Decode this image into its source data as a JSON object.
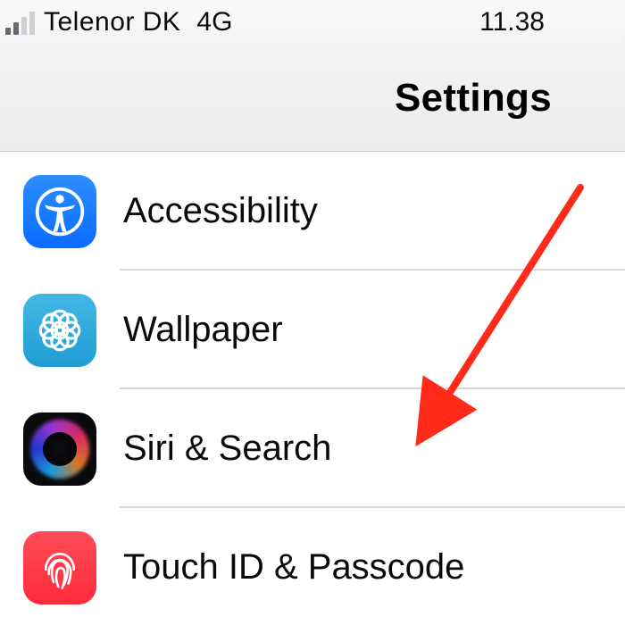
{
  "status_bar": {
    "carrier": "Telenor DK",
    "network": "4G",
    "time": "11.38"
  },
  "header": {
    "title": "Settings"
  },
  "rows": {
    "accessibility": {
      "label": "Accessibility"
    },
    "wallpaper": {
      "label": "Wallpaper"
    },
    "siri": {
      "label": "Siri & Search"
    },
    "touchid": {
      "label": "Touch ID & Passcode"
    }
  },
  "annotation": {
    "arrow_color": "#ff2a1a"
  }
}
